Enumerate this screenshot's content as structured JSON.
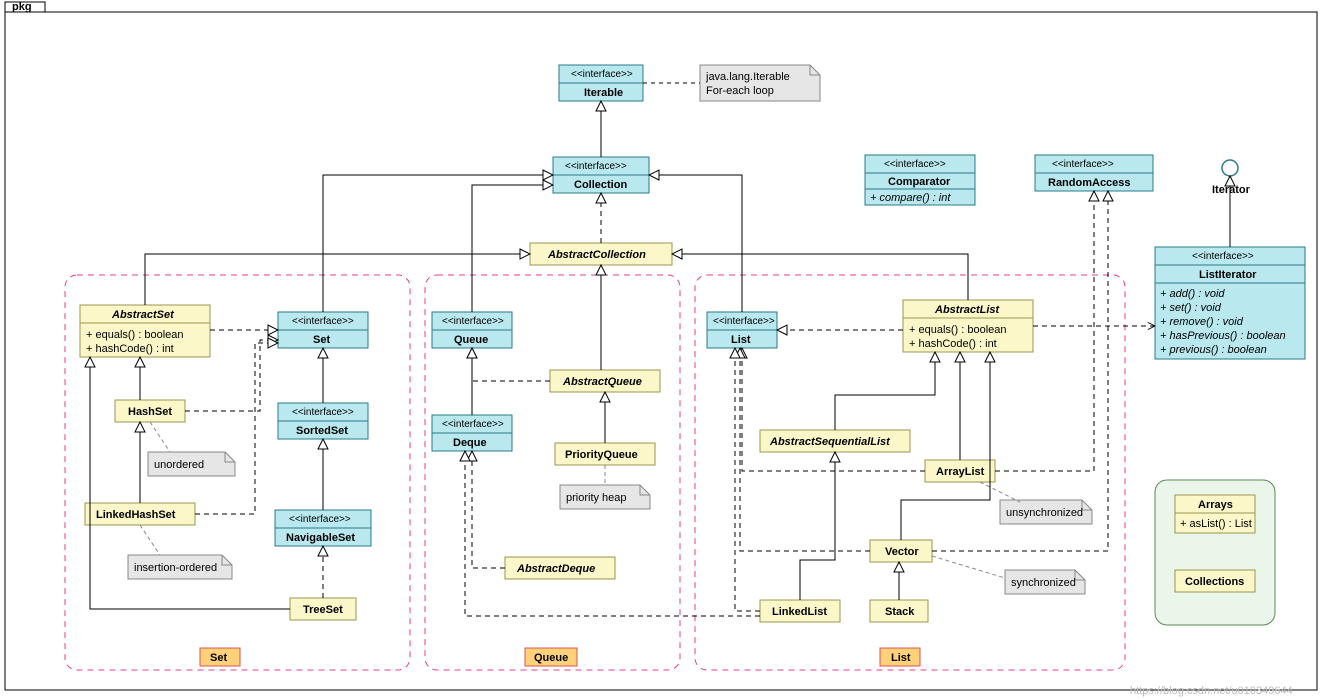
{
  "pkg_label": "pkg",
  "stereotype_interface": "<<interface>>",
  "iterable": {
    "name": "Iterable"
  },
  "iterable_note": {
    "line1": "java.lang.Iterable",
    "line2": "For-each loop"
  },
  "collection": {
    "name": "Collection"
  },
  "abstractCollection": {
    "name": "AbstractCollection"
  },
  "comparator": {
    "name": "Comparator",
    "method": "+ compare() : int"
  },
  "randomAccess": {
    "name": "RandomAccess"
  },
  "iterator": {
    "name": "Iterator"
  },
  "listIterator": {
    "name": "ListIterator",
    "m1": "+ add() : void",
    "m2": "+ set() : void",
    "m3": "+ remove() : void",
    "m4": "+ hasPrevious() : boolean",
    "m5": "+ previous() : boolean"
  },
  "arrays": {
    "name": "Arrays",
    "method": "+ asList() : List"
  },
  "collections": {
    "name": "Collections"
  },
  "abstractSet": {
    "name": "AbstractSet",
    "m1": "+ equals() : boolean",
    "m2": "+ hashCode() : int"
  },
  "set": {
    "name": "Set"
  },
  "sortedSet": {
    "name": "SortedSet"
  },
  "navigableSet": {
    "name": "NavigableSet"
  },
  "hashSet": {
    "name": "HashSet"
  },
  "linkedHashSet": {
    "name": "LinkedHashSet"
  },
  "treeSet": {
    "name": "TreeSet"
  },
  "note_unordered": "unordered",
  "note_insertion": "insertion-ordered",
  "queue": {
    "name": "Queue"
  },
  "deque": {
    "name": "Deque"
  },
  "abstractQueue": {
    "name": "AbstractQueue"
  },
  "priorityQueue": {
    "name": "PriorityQueue"
  },
  "note_priorityHeap": "priority heap",
  "abstractDeque": {
    "name": "AbstractDeque"
  },
  "list": {
    "name": "List"
  },
  "abstractList": {
    "name": "AbstractList",
    "m1": "+ equals() : boolean",
    "m2": "+ hashCode() : int"
  },
  "abstractSequentialList": {
    "name": "AbstractSequentialList"
  },
  "arrayList": {
    "name": "ArrayList"
  },
  "note_unsync": "unsynchronized",
  "vector": {
    "name": "Vector"
  },
  "note_sync": "synchronized",
  "stack": {
    "name": "Stack"
  },
  "linkedList": {
    "name": "LinkedList"
  },
  "group_set": "Set",
  "group_queue": "Queue",
  "group_list": "List",
  "watermark": "https://blog.csdn.net/u010349644"
}
